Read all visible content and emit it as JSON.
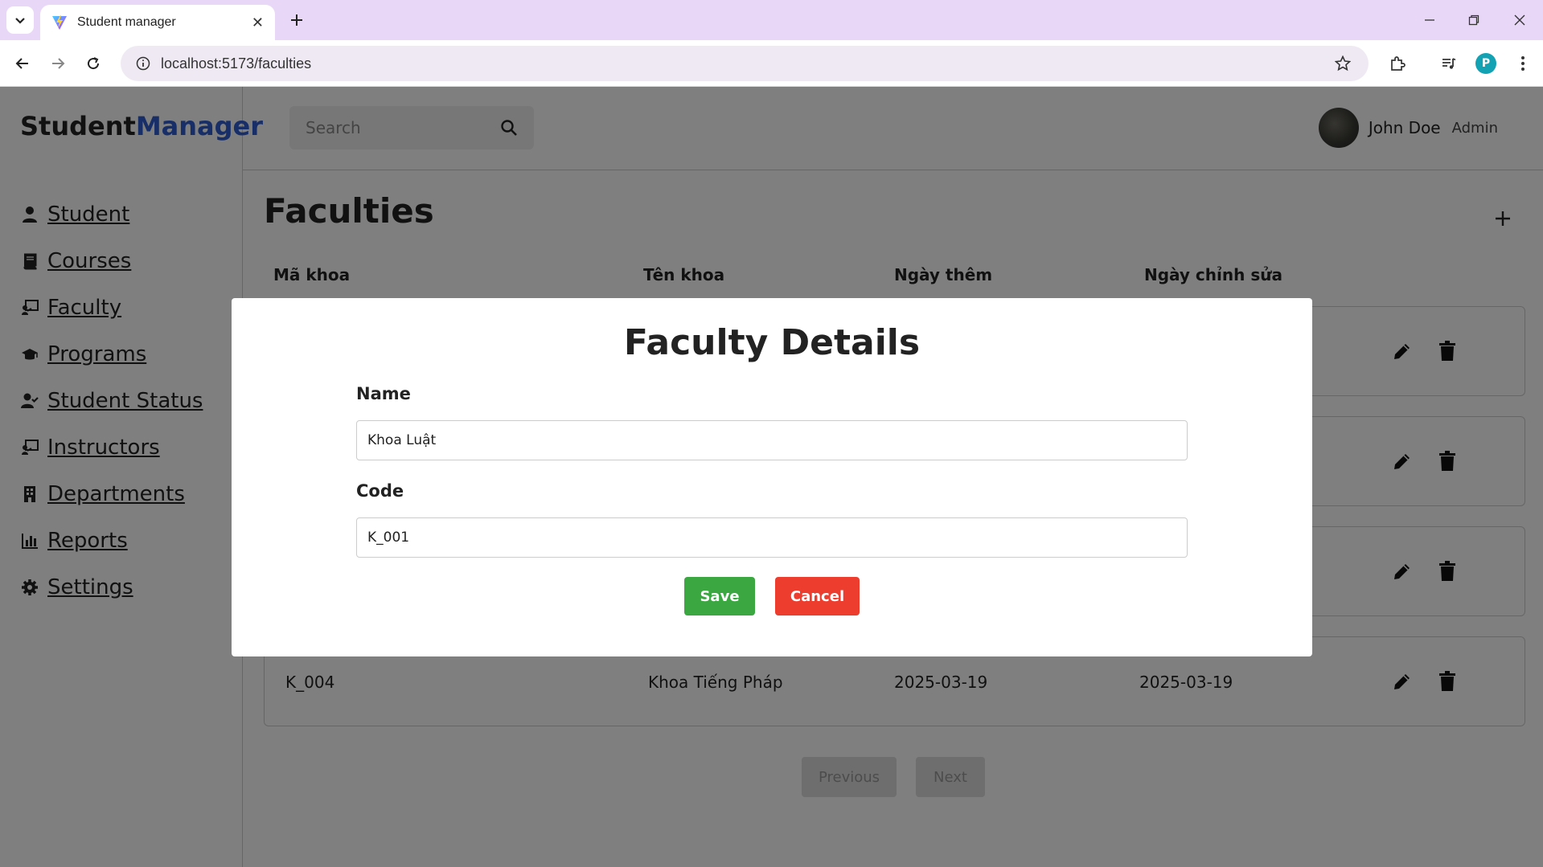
{
  "browser": {
    "tab_title": "Student manager",
    "url": "localhost:5173/faculties",
    "profile_initial": "P"
  },
  "app": {
    "logo_part1": "Student",
    "logo_part2": "Manager",
    "accent_color": "#2f5cd0",
    "nav": [
      {
        "label": "Student",
        "icon": "user-icon"
      },
      {
        "label": "Courses",
        "icon": "book-icon"
      },
      {
        "label": "Faculty",
        "icon": "chalkboard-teacher-icon"
      },
      {
        "label": "Programs",
        "icon": "graduation-cap-icon"
      },
      {
        "label": "Student Status",
        "icon": "user-check-icon"
      },
      {
        "label": "Instructors",
        "icon": "chalkboard-teacher-icon"
      },
      {
        "label": "Departments",
        "icon": "building-icon"
      },
      {
        "label": "Reports",
        "icon": "chart-bar-icon"
      },
      {
        "label": "Settings",
        "icon": "gear-icon"
      }
    ],
    "search_placeholder": "Search",
    "user": {
      "name": "John Doe",
      "role": "Admin"
    }
  },
  "page": {
    "title": "Faculties",
    "headers": [
      "Mã khoa",
      "Tên khoa",
      "Ngày thêm",
      "Ngày chỉnh sửa"
    ],
    "visible_row": {
      "code": "K_004",
      "name": "Khoa Tiếng Pháp",
      "created": "2025-03-19",
      "updated": "2025-03-19"
    },
    "prev_label": "Previous",
    "next_label": "Next"
  },
  "modal": {
    "title": "Faculty Details",
    "name_label": "Name",
    "name_value": "Khoa Luật",
    "code_label": "Code",
    "code_value": "K_001",
    "save_label": "Save",
    "cancel_label": "Cancel",
    "save_color": "#3aa741",
    "cancel_color": "#ec3d2f"
  }
}
